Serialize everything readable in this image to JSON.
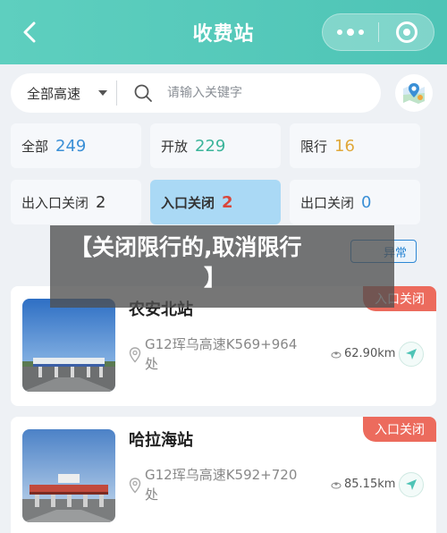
{
  "header": {
    "title": "收费站"
  },
  "search": {
    "selected_road": "全部高速",
    "placeholder": "请输入关键字"
  },
  "filters": [
    {
      "label": "全部",
      "count": "249",
      "color": "#3a8fd6"
    },
    {
      "label": "开放",
      "count": "229",
      "color": "#3bb49a"
    },
    {
      "label": "限行",
      "count": "16",
      "color": "#e0a83a"
    },
    {
      "label": "出入口关闭",
      "count": "2",
      "color": "#333333"
    },
    {
      "label": "入口关闭",
      "count": "2",
      "color": "#d9463a"
    },
    {
      "label": "出口关闭",
      "count": "0",
      "color": "#3a8fd6"
    }
  ],
  "banner": {
    "line1": "【关闭限行的,取消限行",
    "line2": "】",
    "right_chip": "异常"
  },
  "stations": [
    {
      "name": "农安北站",
      "address": "G12珲乌高速K569+964处",
      "distance": "62.90km",
      "status": "入口关闭"
    },
    {
      "name": "哈拉海站",
      "address": "G12珲乌高速K592+720处",
      "distance": "85.15km",
      "status": "入口关闭"
    }
  ],
  "colors": {
    "header": "#5ecfbf",
    "active_filter": "#aad9f5",
    "status_tag": "#ec6b5d"
  }
}
